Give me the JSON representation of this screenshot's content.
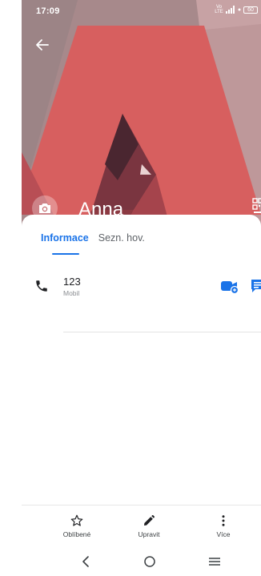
{
  "status_bar": {
    "time": "17:09",
    "network_label": "Vo LTE",
    "battery_level": "60"
  },
  "contact": {
    "name": "Anna"
  },
  "tabs": [
    {
      "label": "Informace",
      "active": true
    },
    {
      "label": "Sezn. hov.",
      "active": false
    }
  ],
  "phone": {
    "number": "123",
    "type": "Mobil"
  },
  "actions": {
    "favorite_label": "Oblíbené",
    "edit_label": "Upravit",
    "more_label": "Více"
  },
  "colors": {
    "accent": "#1a73e8",
    "header_red": "#d85a5a"
  },
  "icons": {
    "back": "arrow-left-icon",
    "camera": "camera-icon",
    "qr": "qr-code-icon",
    "phone": "phone-icon",
    "video": "video-call-icon",
    "message": "message-icon",
    "favorite": "star-outline-icon",
    "edit": "pencil-icon",
    "more": "more-vertical-icon",
    "nav_back": "chevron-left-icon",
    "nav_home": "circle-icon",
    "nav_menu": "menu-icon"
  }
}
